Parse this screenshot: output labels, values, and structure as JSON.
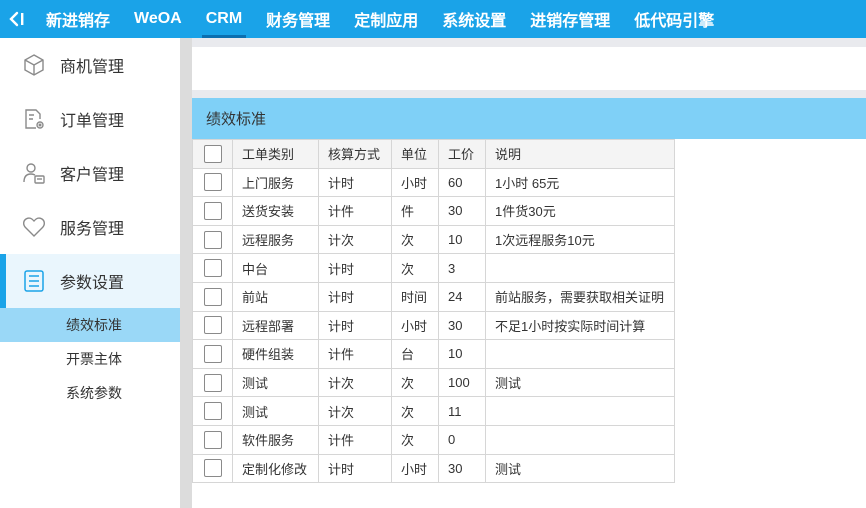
{
  "topnav": {
    "items": [
      "新进销存",
      "WeOA",
      "CRM",
      "财务管理",
      "定制应用",
      "系统设置",
      "进销存管理",
      "低代码引擎"
    ],
    "active": "CRM"
  },
  "sidebar": {
    "items": [
      {
        "label": "商机管理",
        "icon": "cube-icon"
      },
      {
        "label": "订单管理",
        "icon": "document-gear-icon"
      },
      {
        "label": "客户管理",
        "icon": "user-card-icon"
      },
      {
        "label": "服务管理",
        "icon": "heart-icon"
      },
      {
        "label": "参数设置",
        "icon": "list-icon"
      }
    ],
    "subitems": [
      "绩效标准",
      "开票主体",
      "系统参数"
    ]
  },
  "panel": {
    "title": "绩效标准"
  },
  "table": {
    "headers": [
      "工单类别",
      "核算方式",
      "单位",
      "工价",
      "说明"
    ],
    "rows": [
      [
        "上门服务",
        "计时",
        "小时",
        "60",
        "1小时 65元"
      ],
      [
        "送货安装",
        "计件",
        "件",
        "30",
        "1件货30元"
      ],
      [
        "远程服务",
        "计次",
        "次",
        "10",
        "1次远程服务10元"
      ],
      [
        "中台",
        "计时",
        "次",
        "3",
        ""
      ],
      [
        "前站",
        "计时",
        "时间",
        "24",
        "前站服务，需要获取相关证明"
      ],
      [
        "远程部署",
        "计时",
        "小时",
        "30",
        "不足1小时按实际时间计算"
      ],
      [
        "硬件组装",
        "计件",
        "台",
        "10",
        ""
      ],
      [
        "测试",
        "计次",
        "次",
        "100",
        "测试"
      ],
      [
        "测试",
        "计次",
        "次",
        "11",
        ""
      ],
      [
        "软件服务",
        "计件",
        "次",
        "0",
        ""
      ],
      [
        "定制化修改",
        "计时",
        "小时",
        "30",
        "测试"
      ]
    ]
  }
}
